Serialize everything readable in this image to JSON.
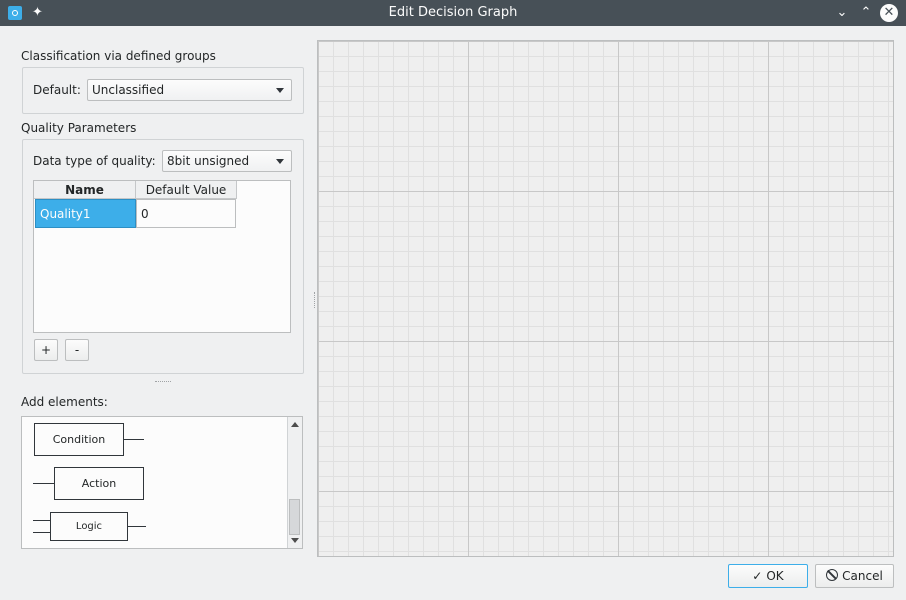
{
  "window": {
    "title": "Edit Decision Graph"
  },
  "classification": {
    "section_title": "Classification via defined groups",
    "default_label": "Default:",
    "default_value": "Unclassified"
  },
  "quality": {
    "section_title": "Quality Parameters",
    "data_type_label": "Data type of quality:",
    "data_type_value": "8bit unsigned",
    "columns": [
      "Name",
      "Default Value"
    ],
    "rows": [
      {
        "name": "Quality1",
        "default_value": "0"
      }
    ],
    "add_label": "+",
    "remove_label": "-"
  },
  "elements": {
    "section_title": "Add elements:",
    "items": [
      "Condition",
      "Action",
      "Logic"
    ]
  },
  "buttons": {
    "ok": "OK",
    "cancel": "Cancel"
  },
  "icons": {
    "app": "app-icon",
    "pin": "pin-icon",
    "minimize": "chevron-down-icon",
    "maximize": "chevron-up-icon",
    "close": "close-icon",
    "ok": "check-icon",
    "cancel": "cancel-icon"
  },
  "colors": {
    "titlebar": "#475057",
    "accent": "#3daee9"
  }
}
